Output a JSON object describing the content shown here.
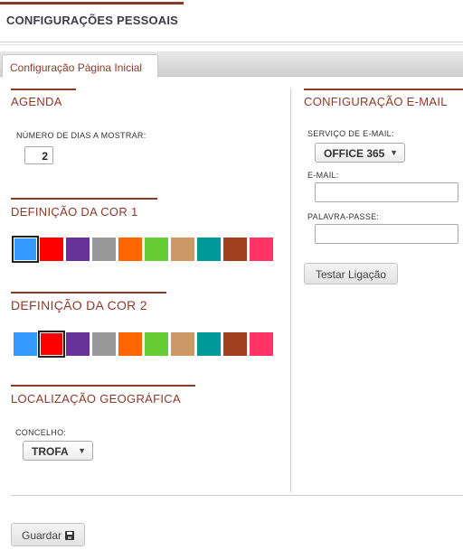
{
  "header": {
    "title": "CONFIGURAÇÕES PESSOAIS"
  },
  "tabs": [
    {
      "label": "Configuração Página Inicial"
    }
  ],
  "agenda": {
    "title": "AGENDA",
    "days_label": "NÚMERO DE DIAS A MOSTRAR:",
    "days_value": "2"
  },
  "color1": {
    "title": "DEFINIÇÃO DA COR 1",
    "selected_index": 0,
    "swatches": [
      "#3399ff",
      "#ff0000",
      "#663399",
      "#999999",
      "#ff6600",
      "#66cc33",
      "#cc9966",
      "#009999",
      "#a0401f",
      "#ff3366"
    ]
  },
  "color2": {
    "title": "DEFINIÇÃO DA COR 2",
    "selected_index": 1,
    "swatches": [
      "#3399ff",
      "#ff0000",
      "#663399",
      "#999999",
      "#ff6600",
      "#66cc33",
      "#cc9966",
      "#009999",
      "#a0401f",
      "#ff3366"
    ]
  },
  "location": {
    "title": "LOCALIZAÇÃO GEOGRÁFICA",
    "county_label": "CONCELHO:",
    "county_value": "TROFA"
  },
  "email": {
    "title": "CONFIGURAÇÃO E-MAIL",
    "service_label": "SERVIÇO DE E-MAIL:",
    "service_value": "OFFICE 365",
    "email_label": "E-MAIL:",
    "email_value": "",
    "password_label": "PALAVRA-PASSE:",
    "password_value": "",
    "test_button": "Testar Ligação"
  },
  "footer": {
    "save_button": "Guardar"
  },
  "colors": {
    "accent": "#8b3a2a"
  }
}
